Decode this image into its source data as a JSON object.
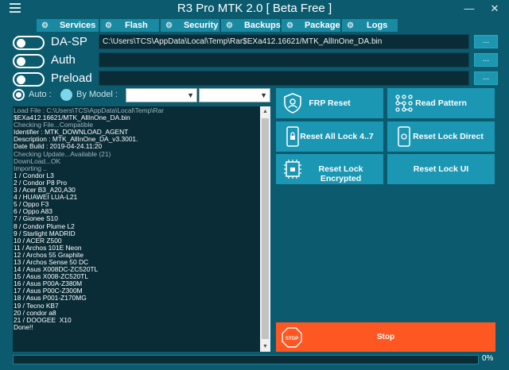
{
  "window": {
    "title": "R3 Pro MTK 2.0 [ Beta Free ]",
    "minimize": "—",
    "close": "✕"
  },
  "tabs": [
    {
      "label": "Services",
      "icon": "services-icon"
    },
    {
      "label": "Flash",
      "icon": "flash-icon"
    },
    {
      "label": "Security",
      "icon": "security-icon"
    },
    {
      "label": "Backups",
      "icon": "backups-icon"
    },
    {
      "label": "Package",
      "icon": "package-icon"
    },
    {
      "label": "Logs",
      "icon": "logs-icon"
    }
  ],
  "rows": {
    "dasp": {
      "label": "DA-SP",
      "enabled": false,
      "value": "C:\\Users\\TCS\\AppData\\Local\\Temp\\Rar$EXa412.16621/MTK_AllInOne_DA.bin",
      "browse": "..."
    },
    "auth": {
      "label": "Auth",
      "enabled": false,
      "value": "",
      "browse": "..."
    },
    "preload": {
      "label": "Preload",
      "enabled": false,
      "value": "",
      "browse": "..."
    }
  },
  "selection": {
    "auto_label": "Auto :",
    "auto_selected": true,
    "by_model_label": "By Model :",
    "brand_value": "",
    "model_value": ""
  },
  "log": {
    "lines": [
      {
        "text": "Load File : C:\\Users\\TCS\\AppData\\Local\\Temp\\Rar",
        "style": "muted"
      },
      {
        "text": "$EXa412.16621/MTK_AllInOne_DA.bin",
        "style": "bright"
      },
      {
        "text": "Checking File...Compatible",
        "style": "muted"
      },
      {
        "text": "Identifier : MTK_DOWNLOAD_AGENT",
        "style": "bright"
      },
      {
        "text": "Description : MTK_AllInOne_DA_v3.3001.",
        "style": "bright"
      },
      {
        "text": "Date Build : 2019-04-24.11:20",
        "style": "bright"
      },
      {
        "text": "Checking Update...Available (21)",
        "style": "muted"
      },
      {
        "text": "DownLoad...OK",
        "style": "muted"
      },
      {
        "text": "Importing ..",
        "style": "muted"
      },
      {
        "text": "1 / Condor L3",
        "style": "bright"
      },
      {
        "text": "2 / Condor P8 Pro",
        "style": "bright"
      },
      {
        "text": "3 / Acer B3_A20,A30",
        "style": "bright"
      },
      {
        "text": "4 / HUAWEI LUA-L21",
        "style": "bright"
      },
      {
        "text": "5 / Oppo F3",
        "style": "bright"
      },
      {
        "text": "6 / Oppo A83",
        "style": "bright"
      },
      {
        "text": "7 / Gionee S10",
        "style": "bright"
      },
      {
        "text": "8 / Condor Plume L2",
        "style": "bright"
      },
      {
        "text": "9 / Starlight MADRID",
        "style": "bright"
      },
      {
        "text": "10 / ACER Z500",
        "style": "bright"
      },
      {
        "text": "11 / Archos 101E Neon",
        "style": "bright"
      },
      {
        "text": "12 / Archos 55 Graphite",
        "style": "bright"
      },
      {
        "text": "13 / Archos Sense 50 DC",
        "style": "bright"
      },
      {
        "text": "14 / Asus X008DC-ZC520TL",
        "style": "bright"
      },
      {
        "text": "15 / Asus X008-ZC520TL",
        "style": "bright"
      },
      {
        "text": "16 / Asus P00A-Z380M",
        "style": "bright"
      },
      {
        "text": "17 / Asus P00C-Z300M",
        "style": "bright"
      },
      {
        "text": "18 / Asus P001-Z170MG",
        "style": "bright"
      },
      {
        "text": "19 / Tecno KB7",
        "style": "bright"
      },
      {
        "text": "20 / condor a8",
        "style": "bright"
      },
      {
        "text": "21 / DOOGEE  X10",
        "style": "bright"
      },
      {
        "text": "Done!!",
        "style": "bright"
      }
    ]
  },
  "actions": {
    "frp_reset": "FRP Reset",
    "read_pattern": "Read Pattern",
    "reset_all_lock": "Reset All Lock 4..7",
    "reset_lock_direct": "Reset Lock Direct",
    "reset_lock_encrypted": "Reset Lock Encrypted",
    "reset_lock_ui": "Reset Lock UI",
    "stop": "Stop",
    "stop_icon_text": "STOP"
  },
  "progress": {
    "fraction": 0.0,
    "label": "0%"
  },
  "colors": {
    "background": "#0b5a6e",
    "button": "#1c97b3",
    "stop": "#ff5722",
    "field": "#0a2c36"
  }
}
